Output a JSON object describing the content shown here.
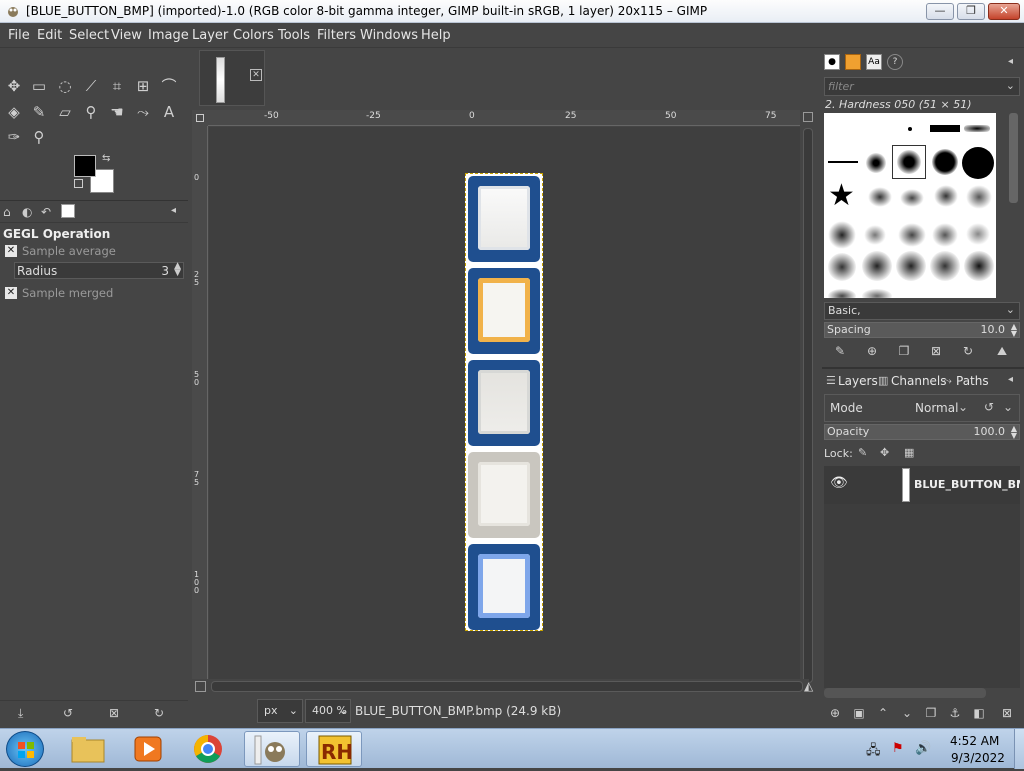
{
  "window": {
    "title": "[BLUE_BUTTON_BMP] (imported)-1.0 (RGB color 8-bit gamma integer, GIMP built-in sRGB, 1 layer) 20x115 – GIMP",
    "min_label": "—",
    "max_label": "❐",
    "close_label": "✕"
  },
  "menu": [
    "File",
    "Edit",
    "Select",
    "View",
    "Image",
    "Layer",
    "Colors",
    "Tools",
    "Filters",
    "Windows",
    "Help"
  ],
  "tool_options": {
    "title": "GEGL Operation",
    "sample_average": "Sample average",
    "radius_label": "Radius",
    "radius_value": "3",
    "sample_merged": "Sample merged"
  },
  "rulers": {
    "h": [
      "-50",
      "-25",
      "0",
      "25",
      "50",
      "75"
    ],
    "v": [
      "0",
      "25",
      "50",
      "75",
      "100"
    ]
  },
  "statusbar": {
    "unit": "px",
    "zoom": "400 %",
    "file": "BLUE_BUTTON_BMP.bmp (24.9 kB)"
  },
  "brushes": {
    "filter_placeholder": "filter",
    "current": "2. Hardness 050 (51 × 51)",
    "set": "Basic,",
    "spacing_label": "Spacing",
    "spacing_value": "10.0"
  },
  "layers": {
    "tabs": [
      "Layers",
      "Channels",
      "Paths"
    ],
    "mode_label": "Mode",
    "mode_value": "Normal",
    "opacity_label": "Opacity",
    "opacity_value": "100.0",
    "lock_label": "Lock:",
    "layer_name": "BLUE_BUTTON_BMP"
  },
  "taskbar": {
    "time": "4:52 AM",
    "date": "9/3/2022"
  }
}
